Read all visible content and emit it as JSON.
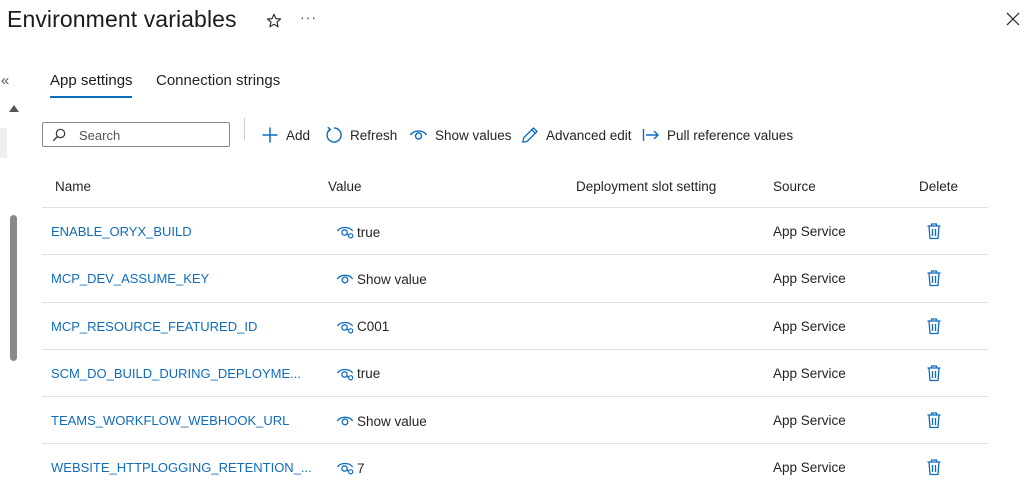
{
  "header": {
    "title": "Environment variables",
    "more_label": "···"
  },
  "tabs": [
    {
      "label": "App settings",
      "active": true
    },
    {
      "label": "Connection strings",
      "active": false
    }
  ],
  "toolbar": {
    "search_placeholder": "Search",
    "search_value": "",
    "add_label": "Add",
    "refresh_label": "Refresh",
    "show_values_label": "Show values",
    "advanced_edit_label": "Advanced edit",
    "pull_reference_label": "Pull reference values"
  },
  "table": {
    "columns": {
      "name": "Name",
      "value": "Value",
      "slot": "Deployment slot setting",
      "source": "Source",
      "delete": "Delete"
    },
    "rows": [
      {
        "name": "ENABLE_ORYX_BUILD",
        "value": "true",
        "value_icon": "hide-eye-icon",
        "source": "App Service"
      },
      {
        "name": "MCP_DEV_ASSUME_KEY",
        "value": "Show value",
        "value_icon": "eye-icon",
        "source": "App Service"
      },
      {
        "name": "MCP_RESOURCE_FEATURED_ID",
        "value": "C001",
        "value_icon": "hide-eye-icon",
        "source": "App Service"
      },
      {
        "name": "SCM_DO_BUILD_DURING_DEPLOYME...",
        "value": "true",
        "value_icon": "hide-eye-icon",
        "source": "App Service"
      },
      {
        "name": "TEAMS_WORKFLOW_WEBHOOK_URL",
        "value": "Show value",
        "value_icon": "eye-icon",
        "source": "App Service"
      },
      {
        "name": "WEBSITE_HTTPLOGGING_RETENTION_...",
        "value": "7",
        "value_icon": "hide-eye-icon",
        "source": "App Service"
      }
    ]
  },
  "colors": {
    "accent": "#0f6cbd",
    "text": "#242424",
    "divider": "#e0e0e0"
  }
}
